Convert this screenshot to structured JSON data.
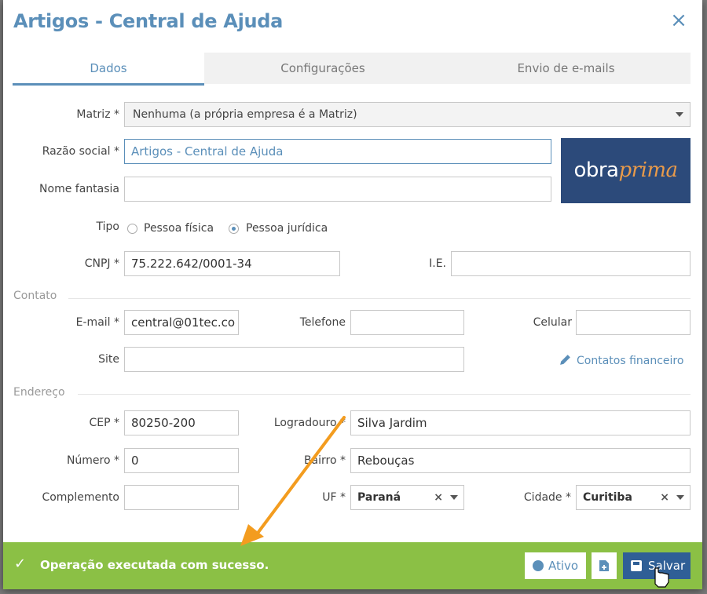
{
  "dialog": {
    "title": "Artigos - Central de Ajuda",
    "close": "×"
  },
  "tabs": [
    {
      "label": "Dados"
    },
    {
      "label": "Configurações"
    },
    {
      "label": "Envio de e-mails"
    }
  ],
  "form": {
    "matriz": {
      "label": "Matriz *",
      "value": "Nenhuma (a própria empresa é a Matriz)"
    },
    "razao_social": {
      "label": "Razão social *",
      "value": "Artigos - Central de Ajuda"
    },
    "nome_fantasia": {
      "label": "Nome fantasia",
      "value": ""
    },
    "tipo": {
      "label": "Tipo",
      "option1": "Pessoa física",
      "option2": "Pessoa jurídica",
      "selected": "Pessoa jurídica"
    },
    "cnpj": {
      "label": "CNPJ *",
      "value": "75.222.642/0001-34"
    },
    "ie": {
      "label": "I.E.",
      "value": ""
    }
  },
  "logo": {
    "text1": "obra",
    "text2": "prima"
  },
  "contato": {
    "title": "Contato",
    "email": {
      "label": "E-mail *",
      "value": "central@01tec.co"
    },
    "telefone": {
      "label": "Telefone",
      "value": ""
    },
    "celular": {
      "label": "Celular",
      "value": ""
    },
    "site": {
      "label": "Site",
      "value": ""
    },
    "contatos_link": "Contatos financeiro"
  },
  "endereco": {
    "title": "Endereço",
    "cep": {
      "label": "CEP *",
      "value": "80250-200"
    },
    "logradouro": {
      "label": "Logradouro *",
      "value": "Silva Jardim"
    },
    "numero": {
      "label": "Número *",
      "value": "0"
    },
    "bairro": {
      "label": "Bairro *",
      "value": "Rebouças"
    },
    "complemento": {
      "label": "Complemento",
      "value": ""
    },
    "uf": {
      "label": "UF *",
      "value": "Paraná"
    },
    "cidade": {
      "label": "Cidade *",
      "value": "Curitiba"
    }
  },
  "footer": {
    "message": "Operação executada com sucesso.",
    "ativo_label": "Ativo",
    "salvar_label": "Salvar"
  },
  "colors": {
    "accent": "#5b8fb9",
    "success": "#8bc045",
    "primary_button": "#2f5f96",
    "annotation_arrow": "#f39c1f"
  }
}
